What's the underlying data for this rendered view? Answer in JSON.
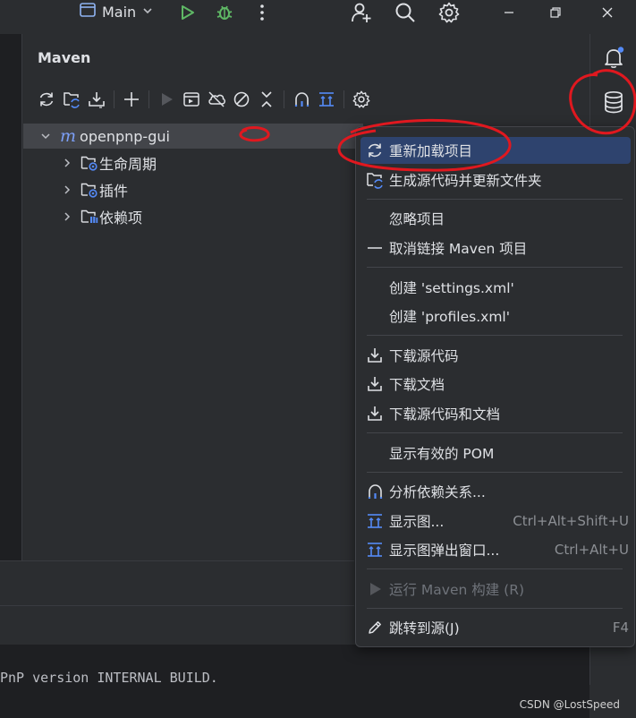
{
  "titlebar": {
    "run_config": "Main",
    "icons": [
      "window-icon",
      "chevron-down-icon",
      "run-icon",
      "debug-icon",
      "more-icon",
      "add-user-icon",
      "search-icon",
      "settings-icon",
      "minimize-icon",
      "restore-icon",
      "close-icon"
    ]
  },
  "maven": {
    "title": "Maven",
    "toolbar": [
      "reload-icon",
      "generate-sources-icon",
      "download-icon",
      "add-icon",
      "run-icon",
      "execute-goal-icon",
      "offline-icon",
      "skip-tests-icon",
      "collapse-icon",
      "analyze-icon",
      "show-diagram-icon",
      "settings-icon"
    ],
    "tree": {
      "root": "openpnp-gui",
      "root_prefix": "m",
      "children": [
        "生命周期",
        "插件",
        "依赖项"
      ]
    }
  },
  "menu": {
    "items": [
      {
        "label": "重新加载项目",
        "icon": "reload-icon",
        "shortcut": ""
      },
      {
        "label": "生成源代码并更新文件夹",
        "icon": "generate-sources-icon",
        "shortcut": ""
      },
      {
        "label": "忽略项目",
        "icon": "",
        "shortcut": ""
      },
      {
        "label": "取消链接 Maven 项目",
        "icon": "minus-icon",
        "shortcut": ""
      },
      {
        "label": "创建 'settings.xml'",
        "icon": "",
        "shortcut": ""
      },
      {
        "label": "创建 'profiles.xml'",
        "icon": "",
        "shortcut": ""
      },
      {
        "label": "下载源代码",
        "icon": "download-icon",
        "shortcut": ""
      },
      {
        "label": "下载文档",
        "icon": "download-icon",
        "shortcut": ""
      },
      {
        "label": "下载源代码和文档",
        "icon": "download-icon",
        "shortcut": ""
      },
      {
        "label": "显示有效的 POM",
        "icon": "",
        "shortcut": ""
      },
      {
        "label": "分析依赖关系...",
        "icon": "analyze-icon",
        "shortcut": ""
      },
      {
        "label": "显示图...",
        "icon": "diagram-icon",
        "shortcut": "Ctrl+Alt+Shift+U"
      },
      {
        "label": "显示图弹出窗口...",
        "icon": "diagram-icon",
        "shortcut": "Ctrl+Alt+U"
      },
      {
        "label": "运行 Maven 构建 (R)",
        "icon": "run-icon",
        "shortcut": ""
      },
      {
        "label": "跳转到源(J)",
        "icon": "edit-icon",
        "shortcut": "F4"
      }
    ]
  },
  "console": {
    "text": "PnP version INTERNAL BUILD."
  },
  "watermark": "CSDN @LostSpeed",
  "colors": {
    "background": "#2b2d30",
    "selection": "#2e436e",
    "accent_blue": "#548af7",
    "run_green": "#5fb865",
    "annotation_red": "#e0181f"
  }
}
